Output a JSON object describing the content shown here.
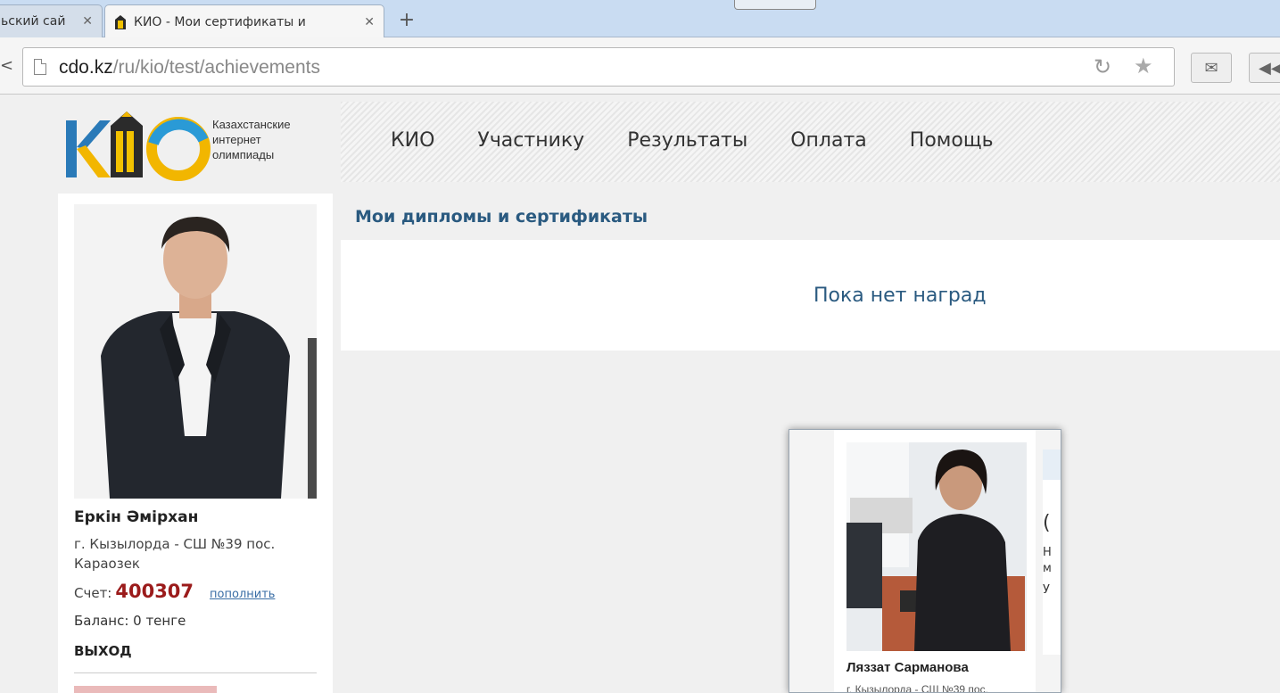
{
  "browser": {
    "tabs": [
      {
        "title": "ьский сай",
        "active": false
      },
      {
        "title": "КИО - Мои сертификаты и",
        "active": true
      }
    ],
    "url_host": "cdo.kz",
    "url_path": "/ru/kio/test/achievements"
  },
  "site": {
    "logo_lines": [
      "Казахстанские",
      "интернет",
      "олимпиады"
    ],
    "nav": [
      "КИО",
      "Участнику",
      "Результаты",
      "Оплата",
      "Помощь"
    ]
  },
  "user": {
    "name": "Еркін Әмірхан",
    "location": "г. Кызылорда - СШ №39 пос. Караозек",
    "account_label": "Счет:",
    "account_number": "400307",
    "topup": "пополнить",
    "balance": "Баланс: 0 тенге",
    "logout": "ВЫХОД"
  },
  "main": {
    "section_title": "Мои дипломы и сертификаты",
    "no_awards": "Пока нет наград"
  },
  "popup": {
    "teacher_name": "Ляззат Сарманова",
    "teacher_location": "г. Кызылорда - СШ №39 пос.",
    "side_fragments": [
      "(",
      "Н",
      "м",
      "У"
    ]
  }
}
